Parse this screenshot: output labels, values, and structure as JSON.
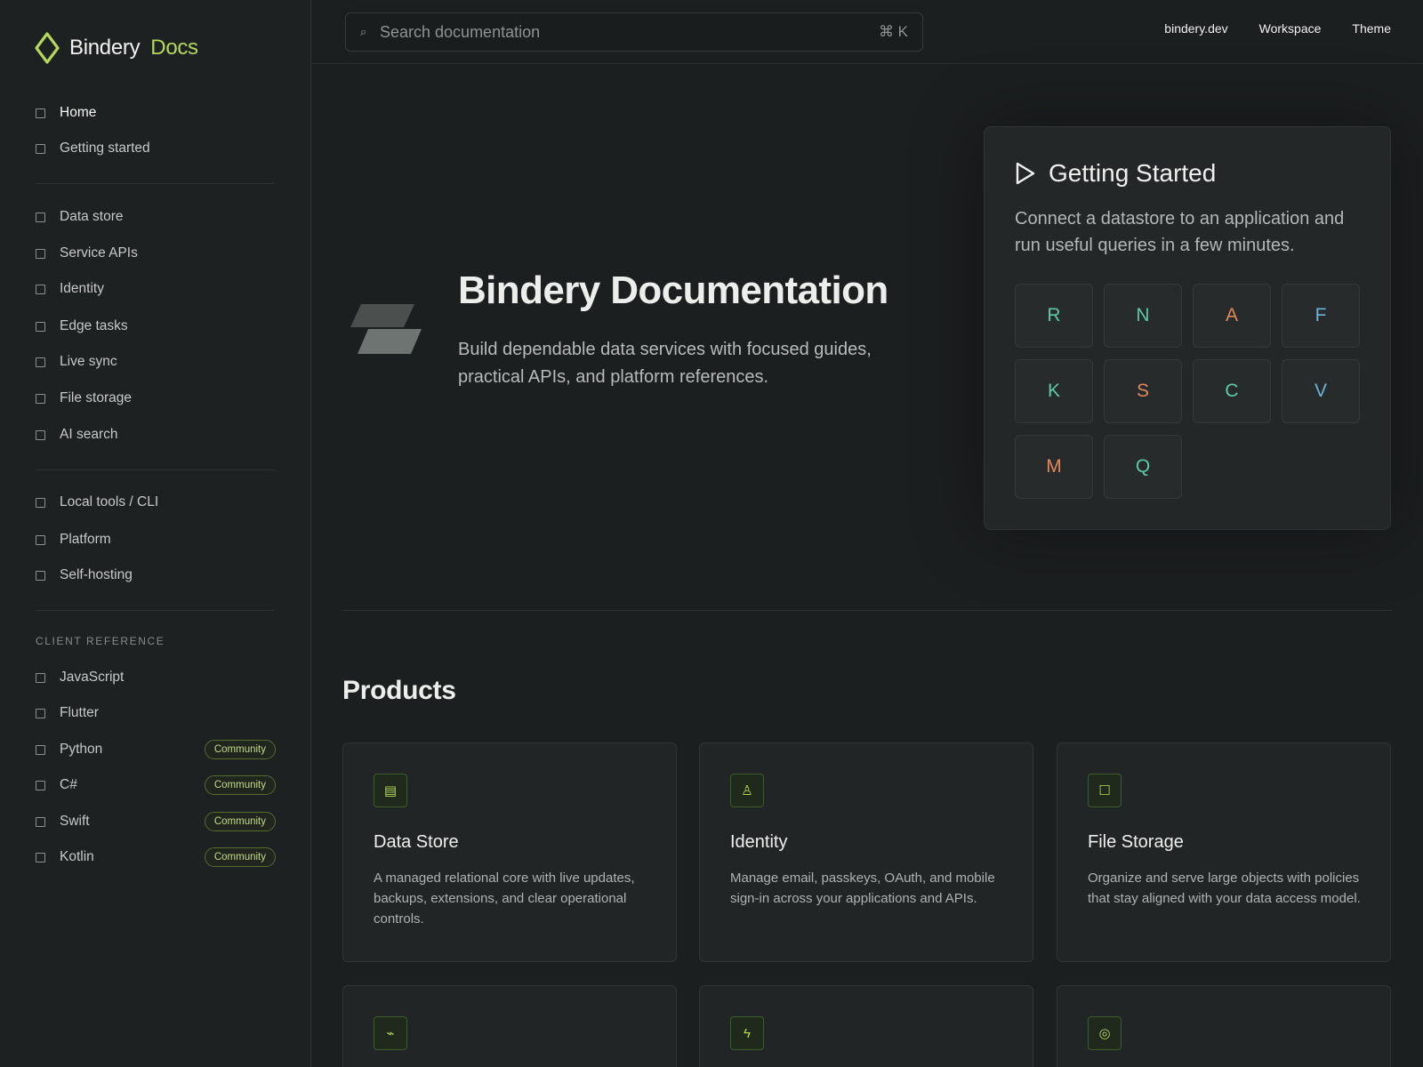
{
  "brand": {
    "name": "Bindery",
    "suffix": "Docs",
    "accent": "#b6d85a"
  },
  "topbar": {
    "search_placeholder": "Search documentation",
    "search_shortcut": "⌘ K",
    "links": [
      "bindery.dev",
      "Workspace",
      "Theme"
    ]
  },
  "sidebar": {
    "group1": [
      "Home",
      "Getting started"
    ],
    "group2": [
      "Data store",
      "Service APIs",
      "Identity",
      "Edge tasks",
      "Live sync",
      "File storage",
      "AI search"
    ],
    "group3": [
      "Local tools / CLI",
      "Platform",
      "Self-hosting"
    ],
    "client_reference_label": "CLIENT REFERENCE",
    "clients": [
      {
        "label": "JavaScript",
        "badge": ""
      },
      {
        "label": "Flutter",
        "badge": ""
      },
      {
        "label": "Python",
        "badge": "Community"
      },
      {
        "label": "C#",
        "badge": "Community"
      },
      {
        "label": "Swift",
        "badge": "Community"
      },
      {
        "label": "Kotlin",
        "badge": "Community"
      }
    ]
  },
  "hero": {
    "title": "Bindery Documentation",
    "subtitle": "Build dependable data services with focused guides, practical APIs, and platform references."
  },
  "getting_started": {
    "title": "Getting Started",
    "description": "Connect a datastore to an application and run useful queries in a few minutes.",
    "tiles": [
      {
        "letter": "R",
        "color": "#5fc9a3"
      },
      {
        "letter": "N",
        "color": "#5fc9a3"
      },
      {
        "letter": "A",
        "color": "#e0875b"
      },
      {
        "letter": "F",
        "color": "#6cb3d9"
      },
      {
        "letter": "K",
        "color": "#5fc9a3"
      },
      {
        "letter": "S",
        "color": "#e0875b"
      },
      {
        "letter": "C",
        "color": "#5fc9a3"
      },
      {
        "letter": "V",
        "color": "#6cb3d9"
      },
      {
        "letter": "M",
        "color": "#e0875b"
      },
      {
        "letter": "Q",
        "color": "#5fc9a3"
      }
    ]
  },
  "products": {
    "title": "Products",
    "cards": [
      {
        "icon": "table-icon",
        "glyph": "▤",
        "title": "Data Store",
        "description": "A managed relational core with live updates, backups, extensions, and clear operational controls."
      },
      {
        "icon": "person-icon",
        "glyph": "♙",
        "title": "Identity",
        "description": "Manage email, passkeys, OAuth, and mobile sign-in across your applications and APIs."
      },
      {
        "icon": "square-icon",
        "glyph": "☐",
        "title": "File Storage",
        "description": "Organize and serve large objects with policies that stay aligned with your data access model."
      },
      {
        "icon": "pulse-icon",
        "glyph": "⌁",
        "title": "",
        "description": ""
      },
      {
        "icon": "bolt-icon",
        "glyph": "ϟ",
        "title": "",
        "description": ""
      },
      {
        "icon": "target-icon",
        "glyph": "◎",
        "title": "",
        "description": ""
      }
    ]
  }
}
